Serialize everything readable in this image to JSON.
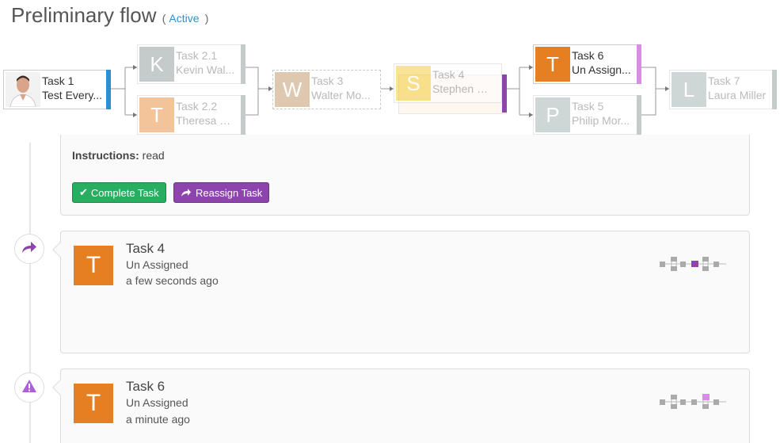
{
  "header": {
    "title": "Preliminary flow",
    "status_open": "(",
    "status": "Active",
    "status_close": ")"
  },
  "flow": {
    "nodes": [
      {
        "id": "task1",
        "title": "Task 1",
        "subtitle": "Test Every...",
        "avatar_type": "photo",
        "bar_color": "#2e8fd0"
      },
      {
        "id": "task21",
        "title": "Task 2.1",
        "subtitle": "Kevin Wal...",
        "initial": "K",
        "avatar_color": "#7f8c8d",
        "bar_color": "#95a5a6"
      },
      {
        "id": "task22",
        "title": "Task 2.2",
        "subtitle": "Theresa H...",
        "initial": "T",
        "avatar_color": "#e9a77f",
        "bar_color": "#95a5a6"
      },
      {
        "id": "task3",
        "title": "Task 3",
        "subtitle": "Walter Mo...",
        "initial": "W",
        "avatar_color": "#c9a77a"
      },
      {
        "id": "task4",
        "title": "Task 4",
        "subtitle": "Stephen W...",
        "initial": "S",
        "avatar_color": "#f4d03f",
        "bar_color": "#9b59b6"
      },
      {
        "id": "task6",
        "title": "Task 6",
        "subtitle": "Un Assign...",
        "initial": "T",
        "avatar_color": "#e67e22",
        "bar_color": "#d98be8"
      },
      {
        "id": "task5",
        "title": "Task 5",
        "subtitle": "Philip Mor...",
        "initial": "P",
        "avatar_color": "#bdc3c7",
        "bar_color": "#95a5a6"
      },
      {
        "id": "task7",
        "title": "Task 7",
        "subtitle": "Laura Miller",
        "initial": "L",
        "avatar_color": "#c8cfd3",
        "bar_color": "#b0b7bb"
      }
    ]
  },
  "instructions_card": {
    "label": "Instructions:",
    "value": "read",
    "complete_label": "Complete Task",
    "reassign_label": "Reassign Task"
  },
  "timeline": [
    {
      "title": "Task 4",
      "assignee": "Un Assigned",
      "time": "a few seconds ago",
      "icon": "share-icon",
      "initial": "T",
      "avatar_color": "#e67e22"
    },
    {
      "title": "Task 6",
      "assignee": "Un Assigned",
      "time": "a minute ago",
      "icon": "warning-icon",
      "initial": "T",
      "avatar_color": "#e67e22"
    }
  ],
  "colors": {
    "accent_blue": "#2e8fd0",
    "green": "#27ae60",
    "purple": "#8e44ad",
    "orange": "#e67e22"
  }
}
